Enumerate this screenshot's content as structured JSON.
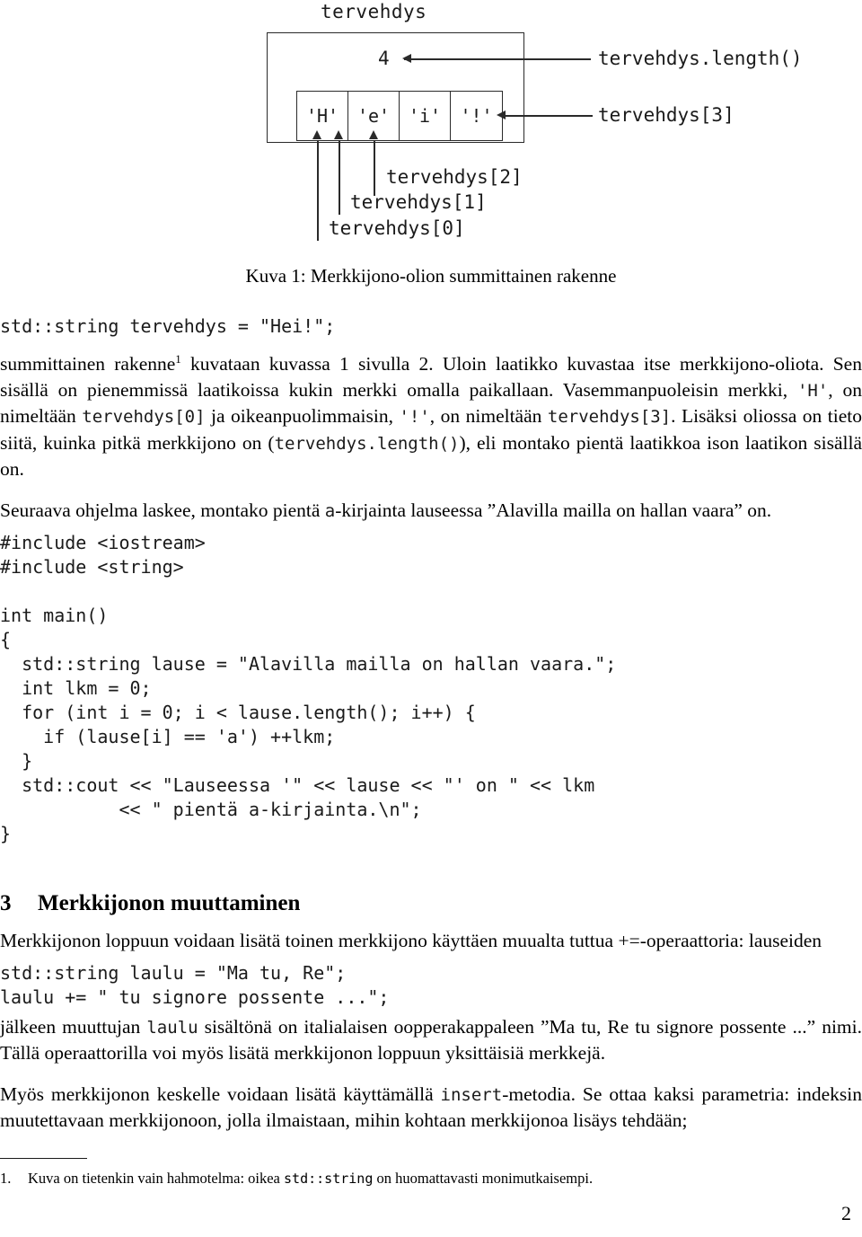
{
  "figure": {
    "variable_label": "tervehdys",
    "length_value": "4",
    "length_label": "tervehdys.length()",
    "cells": [
      "'H'",
      "'e'",
      "'i'",
      "'!'"
    ],
    "index_labels": {
      "i3": "tervehdys[3]",
      "i2": "tervehdys[2]",
      "i1": "tervehdys[1]",
      "i0": "tervehdys[0]"
    },
    "caption": "Kuva 1: Merkkijono-olion summittainen rakenne"
  },
  "body": {
    "code_decl": "std::string tervehdys = \"Hei!\";",
    "para1_a": "summittainen rakenne",
    "para1_fn": "1",
    "para1_b": " kuvataan kuvassa 1 sivulla 2. Uloin laatikko kuvastaa itse merkkijono-oliota. Sen sisällä on pienemmissä laatikoissa kukin merkki omalla paikallaan. Vasemmanpuoleisin merkki, ",
    "para1_c1": "'H'",
    "para1_d": ", on nimeltään ",
    "para1_c2": "tervehdys[0]",
    "para1_e": " ja oikeanpuolimmaisin, ",
    "para1_c3": "'!'",
    "para1_f": ", on nimeltään ",
    "para1_c4": "tervehdys[3]",
    "para1_g": ". Lisäksi oliossa on tieto siitä, kuinka pitkä merkkijono on (",
    "para1_c5": "tervehdys.length()",
    "para1_h": "), eli montako pientä laatikkoa ison laatikon sisällä on.",
    "para2_a": "Seuraava ohjelma laskee, montako pientä ",
    "para2_c1": "a",
    "para2_b": "-kirjainta lauseessa ”Alavilla mailla on hallan vaara” on.",
    "program": "#include <iostream>\n#include <string>\n\nint main()\n{\n  std::string lause = \"Alavilla mailla on hallan vaara.\";\n  int lkm = 0;\n  for (int i = 0; i < lause.length(); i++) {\n    if (lause[i] == 'a') ++lkm;\n  }\n  std::cout << \"Lauseessa '\" << lause << \"' on \" << lkm\n           << \" pientä a-kirjainta.\\n\";\n}"
  },
  "section3": {
    "number": "3",
    "title": "Merkkijonon muuttaminen",
    "para_a": "Merkkijonon loppuun voidaan lisätä toinen merkkijono käyttäen muualta tuttua +=-operaattoria: lauseiden",
    "code": "std::string laulu = \"Ma tu, Re\";\nlaulu += \" tu signore possente ...\";",
    "para2_a": "jälkeen muuttujan ",
    "para2_c1": "laulu",
    "para2_b": " sisältönä on italialaisen oopperakappaleen ”Ma tu, Re tu signore possente ...” nimi. Tällä operaattorilla voi myös lisätä merkkijonon loppuun yksittäisiä merkkejä.",
    "para3_a": "Myös merkkijonon keskelle voidaan lisätä käyttämällä ",
    "para3_c1": "insert",
    "para3_b": "-metodia. Se ottaa kaksi parametria: indeksin muutettavaan merkkijonoon, jolla ilmaistaan, mihin kohtaan merkkijonoa lisäys tehdään;"
  },
  "footnote": {
    "number": "1.",
    "text_a": "Kuva on tietenkin vain hahmotelma: oikea ",
    "code": "std::string",
    "text_b": " on huomattavasti monimutkaisempi."
  },
  "page_number": "2"
}
